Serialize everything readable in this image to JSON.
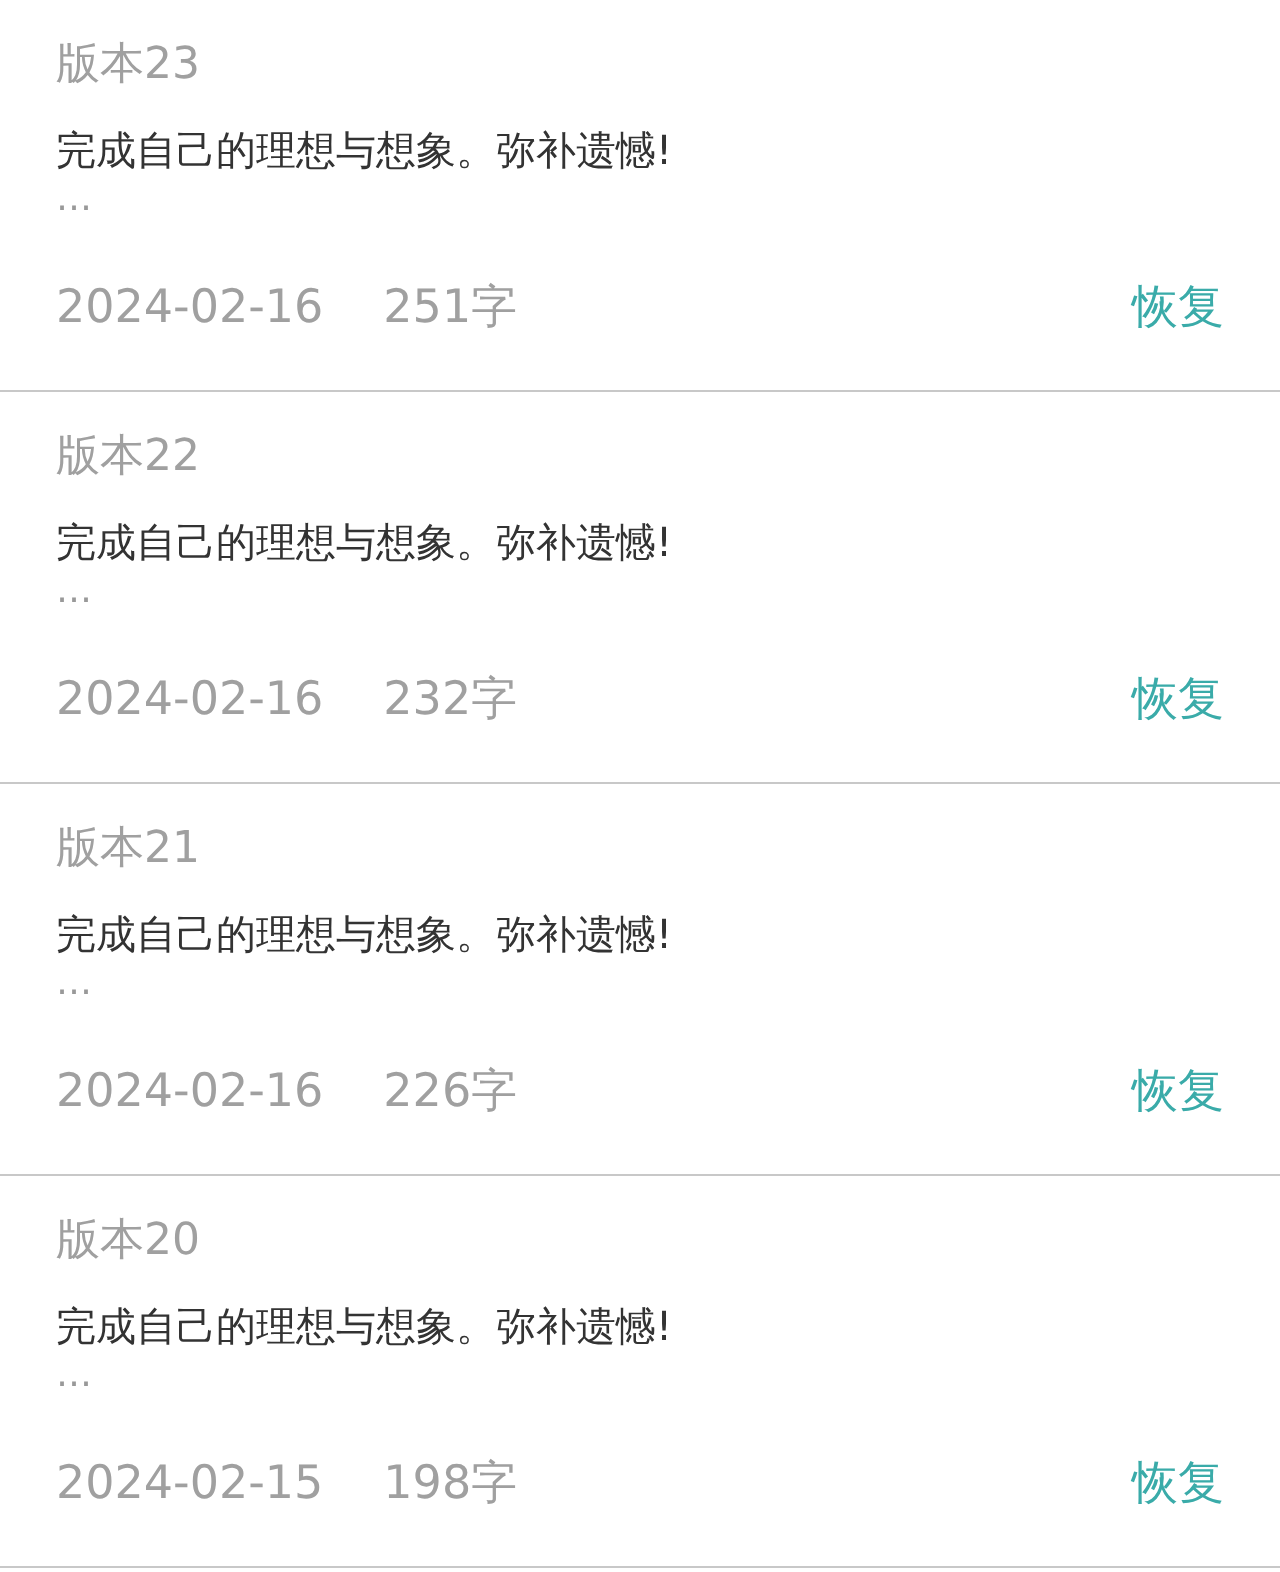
{
  "versions": [
    {
      "title": "版本23",
      "excerpt": "完成自己的理想与想象。弥补遗憾!",
      "more": "…",
      "date": "2024-02-16",
      "count": "251字",
      "action": "恢复"
    },
    {
      "title": "版本22",
      "excerpt": "完成自己的理想与想象。弥补遗憾!",
      "more": "…",
      "date": "2024-02-16",
      "count": "232字",
      "action": "恢复"
    },
    {
      "title": "版本21",
      "excerpt": "完成自己的理想与想象。弥补遗憾!",
      "more": "…",
      "date": "2024-02-16",
      "count": "226字",
      "action": "恢复"
    },
    {
      "title": "版本20",
      "excerpt": "完成自己的理想与想象。弥补遗憾!",
      "more": "…",
      "date": "2024-02-15",
      "count": "198字",
      "action": "恢复"
    }
  ]
}
